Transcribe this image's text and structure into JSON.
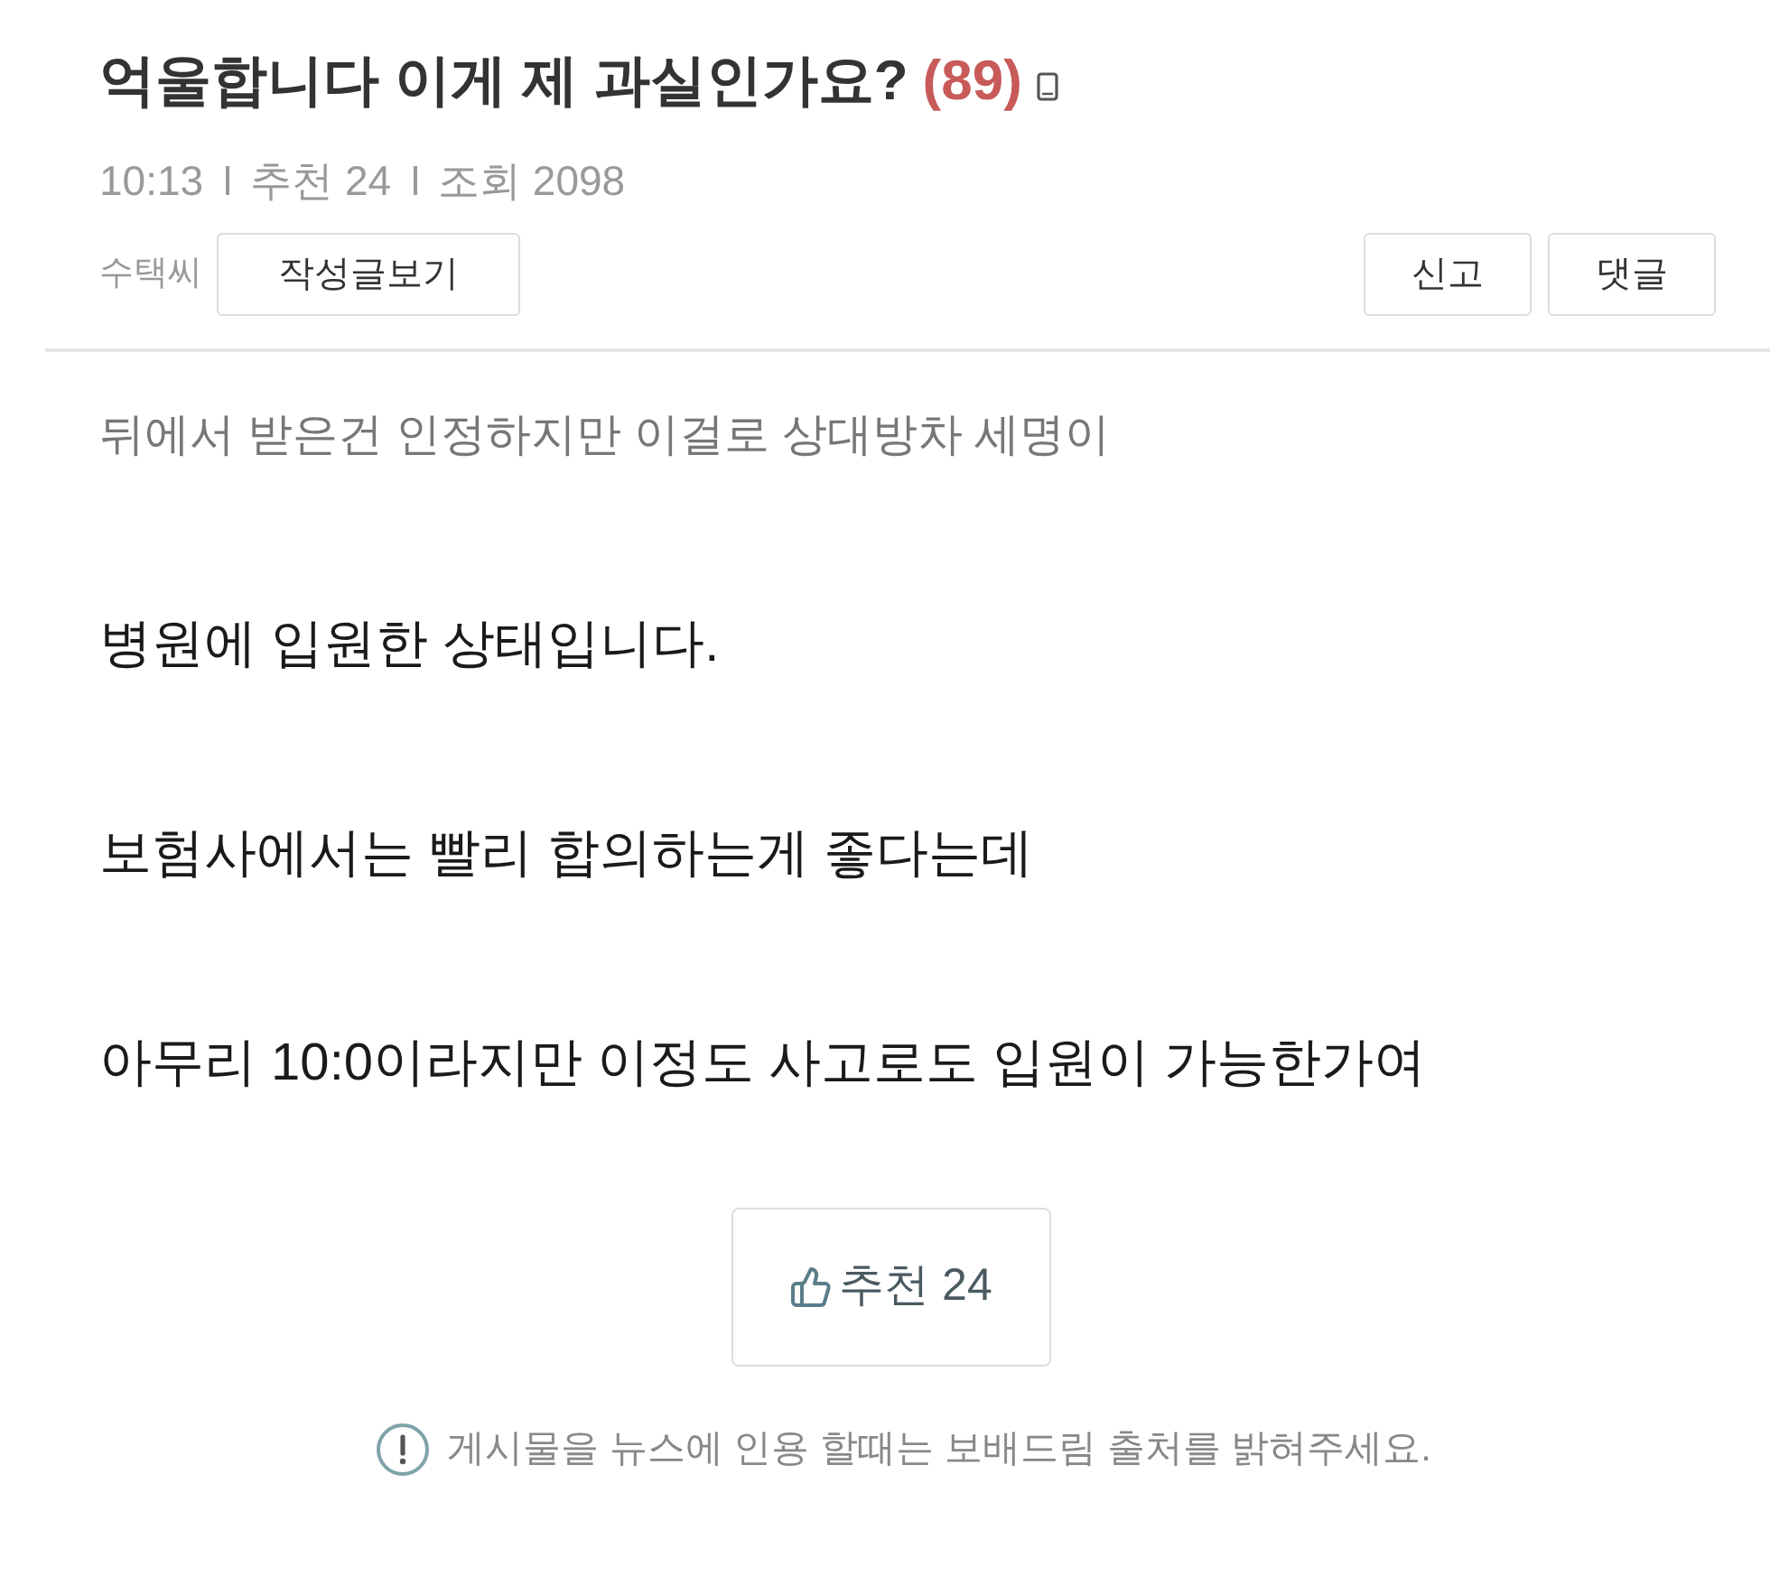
{
  "post": {
    "title": "억울합니다 이게 제 과실인가요?",
    "comment_count": "(89)",
    "meta": [
      "10:13",
      "추천 24",
      "조회 2098"
    ],
    "author": "수택씨",
    "author_posts_button": "작성글보기",
    "actions": [
      "신고",
      "댓글"
    ]
  },
  "body": {
    "paragraphs": [
      {
        "kind": "muted",
        "text": "뒤에서 받은건 인정하지만 이걸로 상대방차 세명이"
      },
      {
        "kind": "plain",
        "text": "병원에 입원한 상태입니다."
      },
      {
        "kind": "plain",
        "text": "보험사에서는 빨리 합의하는게 좋다는데"
      },
      {
        "kind": "plain",
        "text": "아무리 10:0이라지만 이정도 사고로도 입원이 가능한가여"
      }
    ]
  },
  "recommend_button": {
    "label": "추천 24"
  },
  "notice": "게시물을 뉴스에 인용 할때는 보배드림 출처를 밝혀주세요."
}
